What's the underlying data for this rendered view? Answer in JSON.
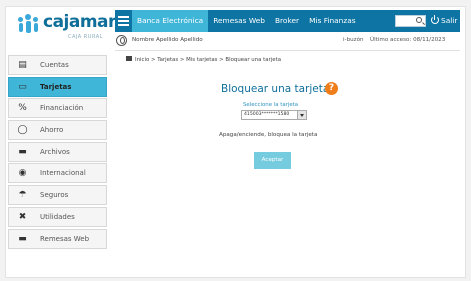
{
  "brand": {
    "name": "cajamar",
    "tagline": "CAJA RURAL"
  },
  "nav": {
    "items": [
      {
        "label": "Banca Electrónica",
        "active": true
      },
      {
        "label": "Remesas Web",
        "active": false
      },
      {
        "label": "Broker",
        "active": false
      },
      {
        "label": "Mis Finanzas",
        "active": false
      }
    ],
    "logout_label": "Salir",
    "accent": "#3fb5d8",
    "bar_color": "#0d74a3"
  },
  "user": {
    "name": "Nombre Apellido Apellido",
    "ibuzon": "i-buzón",
    "last_access": "Último acceso: 08/11/2023"
  },
  "sidebar": {
    "items": [
      {
        "label": "Cuentas",
        "icon": "ledger-icon",
        "active": false
      },
      {
        "label": "Tarjetas",
        "icon": "card-icon",
        "active": true
      },
      {
        "label": "Financiación",
        "icon": "percent-icon",
        "active": false
      },
      {
        "label": "Ahorro",
        "icon": "piggy-bank-icon",
        "active": false
      },
      {
        "label": "Archivos",
        "icon": "folder-icon",
        "active": false
      },
      {
        "label": "Internacional",
        "icon": "globe-icon",
        "active": false
      },
      {
        "label": "Seguros",
        "icon": "umbrella-icon",
        "active": false
      },
      {
        "label": "Utilidades",
        "icon": "tools-icon",
        "active": false
      },
      {
        "label": "Remesas Web",
        "icon": "folder-icon",
        "active": false
      }
    ]
  },
  "breadcrumb": "Inicio > Tarjetas > Mis tarjetas > Bloquear una tarjeta",
  "main": {
    "title": "Bloquear una tarjeta",
    "select_label": "Seleccione la tarjeta",
    "select_value": "415003*******1580",
    "description": "Apaga/enciende, bloquea la tarjeta",
    "accept_label": "Aceptar"
  }
}
